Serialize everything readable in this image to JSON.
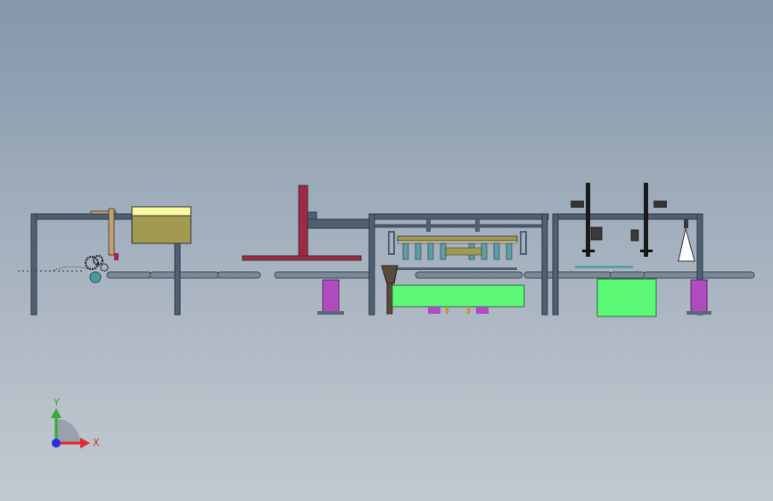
{
  "viewport": {
    "background_top": "#8497ab",
    "background_bottom": "#c3c9d0"
  },
  "colors": {
    "frame": "#4f6072",
    "frame_dark": "#3e4d5c",
    "conveyor": "#7b8896",
    "hopper_fill": "#a39a52",
    "hopper_top": "#fafaa0",
    "red_part": "#a32846",
    "green_block": "#5dfa78",
    "purple_roller": "#b04bc0",
    "orange_rod": "#d09036",
    "nozzle_cone": "#ffffff"
  },
  "triad": {
    "y_label": "Y",
    "x_label": "X",
    "icon": "coordinate-triad-icon",
    "y_color": "#2fae2f",
    "x_color": "#e02c2c",
    "z_color": "#2c2ce0"
  }
}
